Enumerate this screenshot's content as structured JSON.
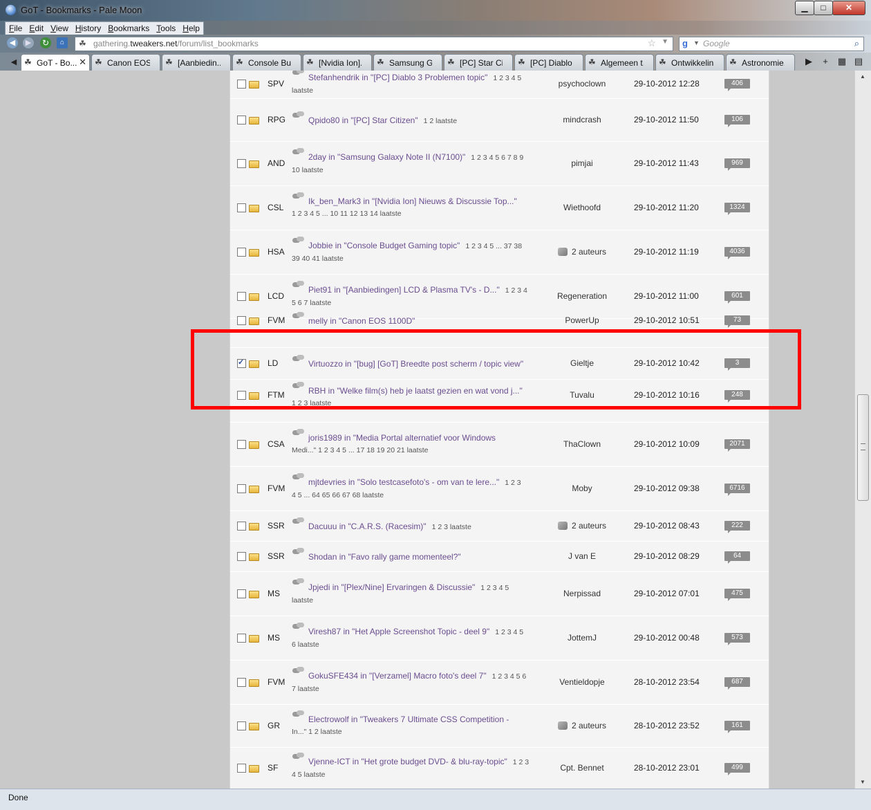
{
  "window": {
    "title": "GoT - Bookmarks - Pale Moon",
    "controls": {
      "minimize": "▁",
      "maximize": "□",
      "close": "✕"
    }
  },
  "menu": [
    "File",
    "Edit",
    "View",
    "History",
    "Bookmarks",
    "Tools",
    "Help"
  ],
  "nav": {
    "url_prefix": "gathering.",
    "url_domain": "tweakers.net",
    "url_path": "/forum/list_bookmarks",
    "search_placeholder": "Google"
  },
  "tabs": [
    {
      "label": "GoT - Bo...",
      "active": true
    },
    {
      "label": "Canon EOS ...",
      "active": false
    },
    {
      "label": "[Aanbiedin...",
      "active": false
    },
    {
      "label": "Console Bu...",
      "active": false
    },
    {
      "label": "[Nvidia Ion]...",
      "active": false
    },
    {
      "label": "Samsung G...",
      "active": false
    },
    {
      "label": "[PC] Star Cit...",
      "active": false
    },
    {
      "label": "[PC] Diablo ...",
      "active": false
    },
    {
      "label": "Algemeen t...",
      "active": false
    },
    {
      "label": "Ontwikkelin...",
      "active": false
    },
    {
      "label": "Astronomie...",
      "active": false
    }
  ],
  "bookmarks": [
    {
      "checked": false,
      "cat": "SPV",
      "topic": "Stefanhendrik in \"[PC] Diablo 3 Problemen topic\"",
      "pages": "1 2 3 4 5",
      "pages2": "laatste",
      "author": "psychoclown",
      "date": "29-10-2012 12:28",
      "count": "406"
    },
    {
      "checked": false,
      "cat": "RPG",
      "topic": "Qpido80 in \"[PC] Star Citizen\"",
      "pages": "1 2 laatste",
      "pages2": "",
      "author": "mindcrash",
      "date": "29-10-2012 11:50",
      "count": "106"
    },
    {
      "checked": false,
      "cat": "AND",
      "topic": "2day in \"Samsung Galaxy Note II (N7100)\"",
      "pages": "1 2 3 4 5 6 7 8 9",
      "pages2": "10 laatste",
      "author": "pimjai",
      "date": "29-10-2012 11:43",
      "count": "969"
    },
    {
      "checked": false,
      "cat": "CSL",
      "topic": "Ik_ben_Mark3 in \"[Nvidia Ion] Nieuws & Discussie Top...\"",
      "pages": "",
      "pages2": "1 2 3 4 5 ... 10 11 12 13 14 laatste",
      "author": "Wiethoofd",
      "date": "29-10-2012 11:20",
      "count": "1324"
    },
    {
      "checked": false,
      "cat": "HSA",
      "topic": "Jobbie in \"Console Budget Gaming topic\"",
      "pages": "1 2 3 4 5 ... 37 38",
      "pages2": "39 40 41 laatste",
      "author": "2 auteurs",
      "multi": true,
      "date": "29-10-2012 11:19",
      "count": "4036"
    },
    {
      "checked": false,
      "cat": "LCD",
      "topic": "Piet91 in \"[Aanbiedingen] LCD & Plasma TV's - D...\"",
      "pages": "1 2 3 4",
      "pages2": "5 6 7 laatste",
      "author": "Regeneration",
      "date": "29-10-2012 11:00",
      "count": "601"
    },
    {
      "checked": false,
      "cat": "FVM",
      "topic": "melly in \"Canon EOS 1100D\"",
      "pages": "",
      "pages2": "",
      "author": "PowerUp",
      "date": "29-10-2012 10:51",
      "count": "73",
      "partial": "top"
    },
    {
      "checked": true,
      "cat": "LD",
      "topic": "Virtuozzo in \"[bug] [GoT] Breedte post scherm / topic view\"",
      "pages": "",
      "pages2": "",
      "author": "Gieltje",
      "date": "29-10-2012 10:42",
      "count": "3",
      "locked": true
    },
    {
      "checked": false,
      "cat": "FTM",
      "topic": "RBH in \"Welke film(s) heb je laatst gezien en wat vond j...\"",
      "pages": "",
      "pages2": "1 2 3 laatste",
      "author": "Tuvalu",
      "date": "29-10-2012 10:16",
      "count": "248",
      "partial": "bottom"
    },
    {
      "checked": false,
      "cat": "CSA",
      "topic": "joris1989 in \"Media Portal alternatief voor Windows",
      "pages": "",
      "pages2": "Medi...\"  1 2 3 4 5 ... 17 18 19 20 21 laatste",
      "author": "ThaClown",
      "date": "29-10-2012 10:09",
      "count": "2071"
    },
    {
      "checked": false,
      "cat": "FVM",
      "topic": "mjtdevries in \"Solo testcasefoto's - om van te lere...\"",
      "pages": "1 2 3",
      "pages2": "4 5 ... 64 65 66 67 68 laatste",
      "author": "Moby",
      "date": "29-10-2012 09:38",
      "count": "6716"
    },
    {
      "checked": false,
      "cat": "SSR",
      "topic": "Dacuuu in \"C.A.R.S. (Racesim)\"",
      "pages": "1 2 3 laatste",
      "pages2": "",
      "author": "2 auteurs",
      "multi": true,
      "date": "29-10-2012 08:43",
      "count": "222"
    },
    {
      "checked": false,
      "cat": "SSR",
      "topic": "Shodan in \"Favo rally game momenteel?\"",
      "pages": "",
      "pages2": "",
      "author": "J van E",
      "date": "29-10-2012 08:29",
      "count": "64"
    },
    {
      "checked": false,
      "cat": "MS",
      "topic": "Jpjedi in \"[Plex/Nine] Ervaringen & Discussie\"",
      "pages": "1 2 3 4 5",
      "pages2": "laatste",
      "author": "Nerpissad",
      "date": "29-10-2012 07:01",
      "count": "475"
    },
    {
      "checked": false,
      "cat": "MS",
      "topic": "Viresh87 in \"Het Apple Screenshot Topic - deel 9\"",
      "pages": "1 2 3 4 5",
      "pages2": "6 laatste",
      "author": "JottemJ",
      "date": "29-10-2012 00:48",
      "count": "573"
    },
    {
      "checked": false,
      "cat": "FVM",
      "topic": "GokuSFE434 in \"[Verzamel] Macro foto's deel 7\"",
      "pages": "1 2 3 4 5 6",
      "pages2": "7 laatste",
      "author": "Ventieldopje",
      "date": "28-10-2012 23:54",
      "count": "687"
    },
    {
      "checked": false,
      "cat": "GR",
      "topic": "Electrowolf in \"Tweakers 7 Ultimate CSS Competition -",
      "pages": "",
      "pages2": "In...\"  1 2 laatste",
      "author": "2 auteurs",
      "multi": true,
      "date": "28-10-2012 23:52",
      "count": "161"
    },
    {
      "checked": false,
      "cat": "SF",
      "topic": "Vjenne-ICT in \"Het grote budget DVD- & blu-ray-topic\"",
      "pages": "1 2 3",
      "pages2": "4 5 laatste",
      "author": "Cpt. Bennet",
      "date": "28-10-2012 23:01",
      "count": "499"
    }
  ],
  "status": "Done"
}
